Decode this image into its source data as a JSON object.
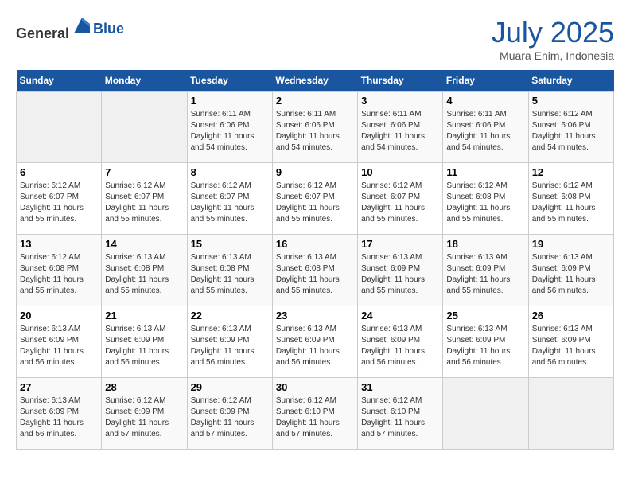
{
  "header": {
    "logo_general": "General",
    "logo_blue": "Blue",
    "title": "July 2025",
    "location": "Muara Enim, Indonesia"
  },
  "weekdays": [
    "Sunday",
    "Monday",
    "Tuesday",
    "Wednesday",
    "Thursday",
    "Friday",
    "Saturday"
  ],
  "weeks": [
    [
      {
        "day": "",
        "info": ""
      },
      {
        "day": "",
        "info": ""
      },
      {
        "day": "1",
        "info": "Sunrise: 6:11 AM\nSunset: 6:06 PM\nDaylight: 11 hours and 54 minutes."
      },
      {
        "day": "2",
        "info": "Sunrise: 6:11 AM\nSunset: 6:06 PM\nDaylight: 11 hours and 54 minutes."
      },
      {
        "day": "3",
        "info": "Sunrise: 6:11 AM\nSunset: 6:06 PM\nDaylight: 11 hours and 54 minutes."
      },
      {
        "day": "4",
        "info": "Sunrise: 6:11 AM\nSunset: 6:06 PM\nDaylight: 11 hours and 54 minutes."
      },
      {
        "day": "5",
        "info": "Sunrise: 6:12 AM\nSunset: 6:06 PM\nDaylight: 11 hours and 54 minutes."
      }
    ],
    [
      {
        "day": "6",
        "info": "Sunrise: 6:12 AM\nSunset: 6:07 PM\nDaylight: 11 hours and 55 minutes."
      },
      {
        "day": "7",
        "info": "Sunrise: 6:12 AM\nSunset: 6:07 PM\nDaylight: 11 hours and 55 minutes."
      },
      {
        "day": "8",
        "info": "Sunrise: 6:12 AM\nSunset: 6:07 PM\nDaylight: 11 hours and 55 minutes."
      },
      {
        "day": "9",
        "info": "Sunrise: 6:12 AM\nSunset: 6:07 PM\nDaylight: 11 hours and 55 minutes."
      },
      {
        "day": "10",
        "info": "Sunrise: 6:12 AM\nSunset: 6:07 PM\nDaylight: 11 hours and 55 minutes."
      },
      {
        "day": "11",
        "info": "Sunrise: 6:12 AM\nSunset: 6:08 PM\nDaylight: 11 hours and 55 minutes."
      },
      {
        "day": "12",
        "info": "Sunrise: 6:12 AM\nSunset: 6:08 PM\nDaylight: 11 hours and 55 minutes."
      }
    ],
    [
      {
        "day": "13",
        "info": "Sunrise: 6:12 AM\nSunset: 6:08 PM\nDaylight: 11 hours and 55 minutes."
      },
      {
        "day": "14",
        "info": "Sunrise: 6:13 AM\nSunset: 6:08 PM\nDaylight: 11 hours and 55 minutes."
      },
      {
        "day": "15",
        "info": "Sunrise: 6:13 AM\nSunset: 6:08 PM\nDaylight: 11 hours and 55 minutes."
      },
      {
        "day": "16",
        "info": "Sunrise: 6:13 AM\nSunset: 6:08 PM\nDaylight: 11 hours and 55 minutes."
      },
      {
        "day": "17",
        "info": "Sunrise: 6:13 AM\nSunset: 6:09 PM\nDaylight: 11 hours and 55 minutes."
      },
      {
        "day": "18",
        "info": "Sunrise: 6:13 AM\nSunset: 6:09 PM\nDaylight: 11 hours and 55 minutes."
      },
      {
        "day": "19",
        "info": "Sunrise: 6:13 AM\nSunset: 6:09 PM\nDaylight: 11 hours and 56 minutes."
      }
    ],
    [
      {
        "day": "20",
        "info": "Sunrise: 6:13 AM\nSunset: 6:09 PM\nDaylight: 11 hours and 56 minutes."
      },
      {
        "day": "21",
        "info": "Sunrise: 6:13 AM\nSunset: 6:09 PM\nDaylight: 11 hours and 56 minutes."
      },
      {
        "day": "22",
        "info": "Sunrise: 6:13 AM\nSunset: 6:09 PM\nDaylight: 11 hours and 56 minutes."
      },
      {
        "day": "23",
        "info": "Sunrise: 6:13 AM\nSunset: 6:09 PM\nDaylight: 11 hours and 56 minutes."
      },
      {
        "day": "24",
        "info": "Sunrise: 6:13 AM\nSunset: 6:09 PM\nDaylight: 11 hours and 56 minutes."
      },
      {
        "day": "25",
        "info": "Sunrise: 6:13 AM\nSunset: 6:09 PM\nDaylight: 11 hours and 56 minutes."
      },
      {
        "day": "26",
        "info": "Sunrise: 6:13 AM\nSunset: 6:09 PM\nDaylight: 11 hours and 56 minutes."
      }
    ],
    [
      {
        "day": "27",
        "info": "Sunrise: 6:13 AM\nSunset: 6:09 PM\nDaylight: 11 hours and 56 minutes."
      },
      {
        "day": "28",
        "info": "Sunrise: 6:12 AM\nSunset: 6:09 PM\nDaylight: 11 hours and 57 minutes."
      },
      {
        "day": "29",
        "info": "Sunrise: 6:12 AM\nSunset: 6:09 PM\nDaylight: 11 hours and 57 minutes."
      },
      {
        "day": "30",
        "info": "Sunrise: 6:12 AM\nSunset: 6:10 PM\nDaylight: 11 hours and 57 minutes."
      },
      {
        "day": "31",
        "info": "Sunrise: 6:12 AM\nSunset: 6:10 PM\nDaylight: 11 hours and 57 minutes."
      },
      {
        "day": "",
        "info": ""
      },
      {
        "day": "",
        "info": ""
      }
    ]
  ]
}
